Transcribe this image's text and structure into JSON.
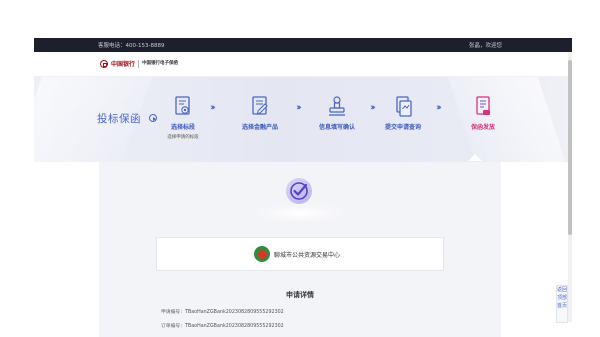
{
  "topbar": {
    "hotline": "客服电话：400-153-8889",
    "welcome": "张晶，欢迎您"
  },
  "header": {
    "logo_main": "中国银行",
    "logo_sub": "中国银行电子保函"
  },
  "banner": {
    "title": "投标保函",
    "steps": [
      {
        "label": "选择标段",
        "sub": "选择申请的标段"
      },
      {
        "label": "选择金融产品",
        "sub": ""
      },
      {
        "label": "信息填写确认",
        "sub": ""
      },
      {
        "label": "提交申请查询",
        "sub": ""
      },
      {
        "label": "保函发放",
        "sub": ""
      }
    ],
    "arrow_glyph": "››››"
  },
  "card": {
    "org_name": "聊城市公共资源交易中心",
    "detail_title": "申请详情",
    "details": [
      {
        "label": "申请编号：",
        "value": "TBaoHanZGBank2023082809555292302"
      },
      {
        "label": "订单编号：",
        "value": "TBaoHanZGBank2023082809555292302"
      }
    ]
  },
  "side_widget": [
    "返回",
    "顶部",
    "首页"
  ],
  "colors": {
    "accent": "#4a67c8",
    "active": "#d8327a",
    "topbar": "#1e1f2c",
    "brand": "#a01318"
  },
  "icons": [
    "target-doc-icon",
    "finance-product-icon",
    "form-confirm-icon",
    "submit-query-icon",
    "guarantee-issue-icon",
    "check-badge-icon",
    "org-emblem-icon",
    "play-circle-icon"
  ]
}
